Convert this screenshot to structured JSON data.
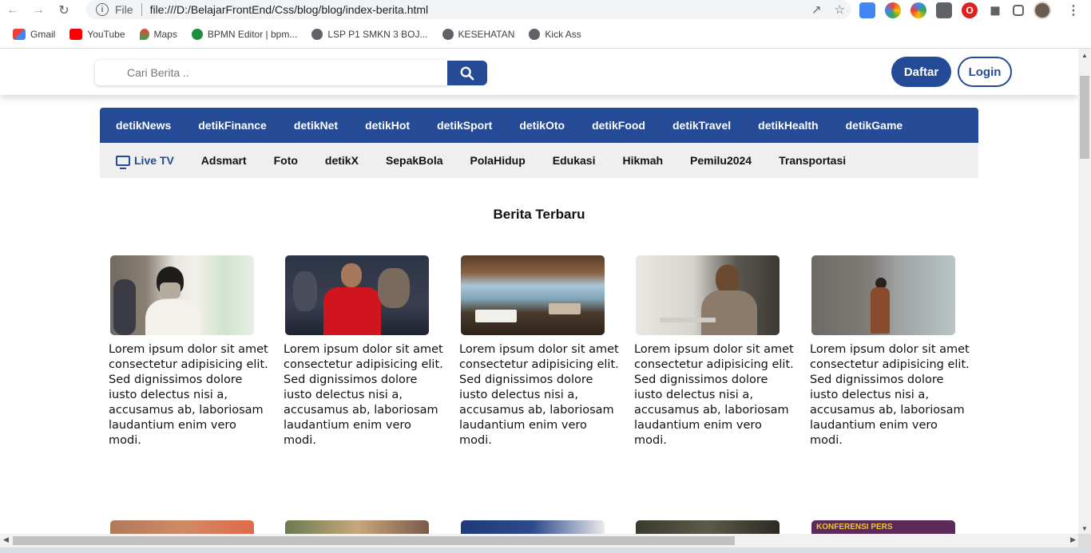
{
  "browser": {
    "scheme": "File",
    "url": "file:///D:/BelajarFrontEnd/Css/blog/blog/index-berita.html",
    "bookmarks": [
      {
        "label": "Gmail",
        "icon": "gmail-icon",
        "color": "#ea4335"
      },
      {
        "label": "YouTube",
        "icon": "youtube-icon",
        "color": "#ff0000"
      },
      {
        "label": "Maps",
        "icon": "maps-icon",
        "color": "#34a853"
      },
      {
        "label": "BPMN Editor | bpm...",
        "icon": "bpmn-icon",
        "color": "#1e8e3e"
      },
      {
        "label": "LSP P1 SMKN 3 BOJ...",
        "icon": "globe-icon",
        "color": "#5f6368"
      },
      {
        "label": "KESEHATAN",
        "icon": "globe-icon",
        "color": "#5f6368"
      },
      {
        "label": "Kick Ass",
        "icon": "globe-icon",
        "color": "#5f6368"
      }
    ]
  },
  "header": {
    "search_placeholder": "Cari Berita ..",
    "daftar_label": "Daftar",
    "login_label": "Login",
    "brand_color": "#254a96"
  },
  "nav_primary": [
    "detikNews",
    "detikFinance",
    "detikNet",
    "detikHot",
    "detikSport",
    "detikOto",
    "detikFood",
    "detikTravel",
    "detikHealth",
    "detikGame"
  ],
  "nav_secondary": {
    "live_label": "Live TV",
    "items": [
      "Adsmart",
      "Foto",
      "detikX",
      "SepakBola",
      "PolaHidup",
      "Edukasi",
      "Hikmah",
      "Pemilu2024",
      "Transportasi"
    ]
  },
  "section": {
    "title": "Berita Terbaru"
  },
  "news": [
    {
      "text": "Lorem ipsum dolor sit amet consectetur adipisicing elit. Sed dignissimos dolore iusto delectus nisi a, accusamus ab, laboriosam laudantium enim vero modi."
    },
    {
      "text": "Lorem ipsum dolor sit amet consectetur adipisicing elit. Sed dignissimos dolore iusto delectus nisi a, accusamus ab, laboriosam laudantium enim vero modi."
    },
    {
      "text": "Lorem ipsum dolor sit amet consectetur adipisicing elit. Sed dignissimos dolore iusto delectus nisi a, accusamus ab, laboriosam laudantium enim vero modi."
    },
    {
      "text": "Lorem ipsum dolor sit amet consectetur adipisicing elit. Sed dignissimos dolore iusto delectus nisi a, accusamus ab, laboriosam laudantium enim vero modi."
    },
    {
      "text": "Lorem ipsum dolor sit amet consectetur adipisicing elit. Sed dignissimos dolore iusto delectus nisi a, accusamus ab, laboriosam laudantium enim vero modi."
    }
  ],
  "row2_banner_text": "KONFERENSI PERS"
}
